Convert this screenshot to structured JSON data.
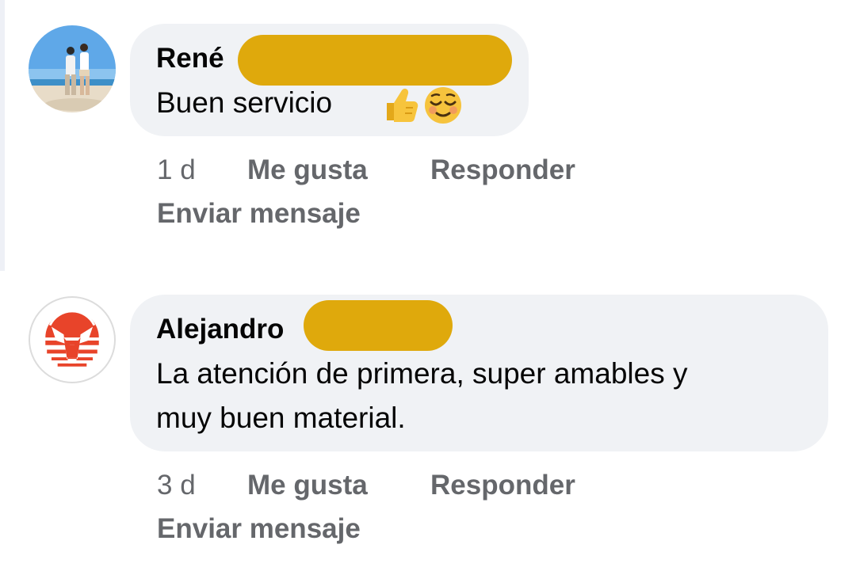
{
  "comments": [
    {
      "author": "René",
      "text_lines": [
        "Buen servicio"
      ],
      "emojis": [
        "thumbs-up",
        "relieved-face"
      ],
      "time": "1 d",
      "like_label": "Me gusta",
      "reply_label": "Responder",
      "message_label": "Enviar mensaje"
    },
    {
      "author": "Alejandro",
      "text_lines": [
        "La atención de primera, super amables y",
        "muy buen material."
      ],
      "time": "3 d",
      "like_label": "Me gusta",
      "reply_label": "Responder",
      "message_label": "Enviar mensaje"
    }
  ],
  "colors": {
    "bubble": "#f0f2f5",
    "redaction": "#dfa90c",
    "meta_text": "#65676b",
    "logo_red": "#e8442a"
  }
}
